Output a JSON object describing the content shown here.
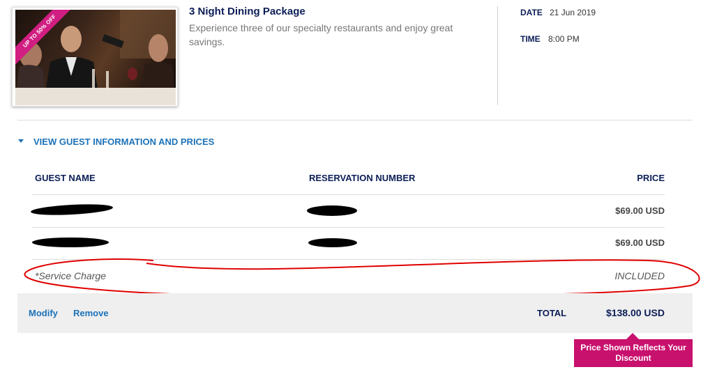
{
  "package": {
    "badge": "UP TO 50% OFF",
    "title": "3 Night Dining Package",
    "description": "Experience three of our specialty restaurants and enjoy great savings.",
    "date_label": "DATE",
    "date_value": "21 Jun 2019",
    "time_label": "TIME",
    "time_value": "8:00 PM"
  },
  "toggle_label": "VIEW GUEST INFORMATION AND PRICES",
  "table": {
    "headers": {
      "guest": "GUEST NAME",
      "reservation": "RESERVATION NUMBER",
      "price": "PRICE"
    },
    "rows": [
      {
        "price": "$69.00 USD"
      },
      {
        "price": "$69.00 USD"
      }
    ],
    "service_charge_label": "*Service Charge",
    "service_charge_value": "INCLUDED"
  },
  "footer": {
    "modify": "Modify",
    "remove": "Remove",
    "total_label": "TOTAL",
    "total_value": "$138.00 USD"
  },
  "tooltip": "Price Shown Reflects Your Discount",
  "colors": {
    "accent": "#1c72b8",
    "navy": "#0c1e57",
    "brand_pink": "#c8106d",
    "annotation_red": "#e00000"
  }
}
